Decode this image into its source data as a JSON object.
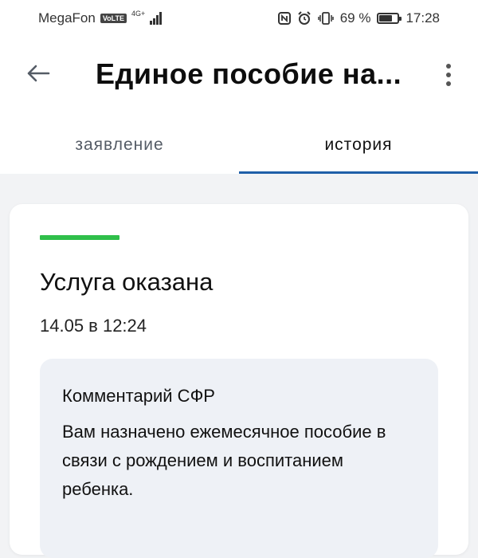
{
  "status_bar": {
    "carrier": "MegaFon",
    "volte": "VoLTE",
    "network": "4G+",
    "battery_percent": "69 %",
    "battery_level": 0.69,
    "time": "17:28",
    "icons": [
      "nfc-icon",
      "alarm-icon",
      "vibrate-icon",
      "battery-icon"
    ]
  },
  "header": {
    "title": "Единое пособие на...",
    "back_icon": "arrow-left-icon",
    "menu_icon": "more-vertical-icon"
  },
  "tabs": [
    {
      "label": "заявление",
      "active": false
    },
    {
      "label": "история",
      "active": true
    }
  ],
  "card": {
    "status_color": "#2fbf4a",
    "status_title": "Услуга оказана",
    "date": "14.05 в 12:24",
    "comment": {
      "heading": "Комментарий СФР",
      "body": "Вам назначено ежемесячное пособие в связи с рождением и воспитанием ребенка."
    }
  },
  "colors": {
    "accent": "#1f5fa8",
    "background": "#f2f3f5",
    "comment_background": "#eef1f6"
  }
}
